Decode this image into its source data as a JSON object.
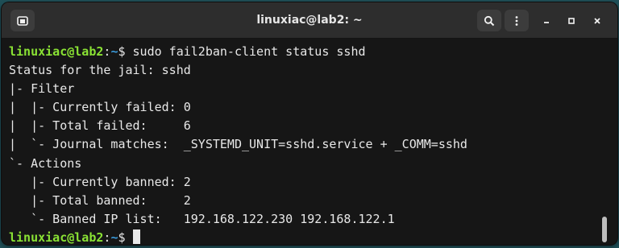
{
  "window": {
    "title": "linuxiac@lab2: ~",
    "icons": {
      "new_tab": "new-terminal-icon",
      "search": "search-icon",
      "menu": "kebab-menu-icon",
      "minimize": "minimize-icon",
      "maximize": "maximize-icon",
      "close": "close-icon"
    }
  },
  "terminal": {
    "command_line": {
      "user_host": "linuxiac@lab2",
      "separator": ":",
      "path": "~",
      "symbol": "$ ",
      "command": "sudo fail2ban-client status sshd"
    },
    "output": [
      "Status for the jail: sshd",
      "|- Filter",
      "|  |- Currently failed: 0",
      "|  |- Total failed:     6",
      "|  `- Journal matches:  _SYSTEMD_UNIT=sshd.service + _COMM=sshd",
      "`- Actions",
      "   |- Currently banned: 2",
      "   |- Total banned:     2",
      "   `- Banned IP list:   192.168.122.230 192.168.122.1"
    ],
    "final_prompt": {
      "user_host": "linuxiac@lab2",
      "separator": ":",
      "path": "~",
      "symbol": "$ "
    }
  },
  "colors": {
    "user_host": "#8ae234",
    "path": "#3a9bdc",
    "text": "#e8e8e8",
    "background": "#161616"
  }
}
